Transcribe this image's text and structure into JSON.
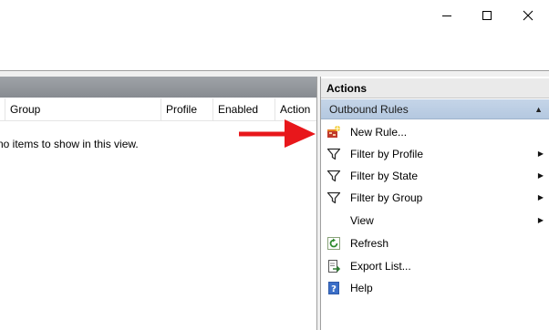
{
  "window": {
    "minimize_icon": "minimize-icon",
    "maximize_icon": "maximize-icon",
    "close_icon": "close-icon"
  },
  "rules_table": {
    "columns": [
      "Group",
      "Profile",
      "Enabled",
      "Action"
    ],
    "empty_message": "no items to show in this view."
  },
  "actions_pane": {
    "title": "Actions",
    "section": "Outbound Rules",
    "items": [
      {
        "label": "New Rule...",
        "icon": "new-rule-icon"
      },
      {
        "label": "Filter by Profile",
        "icon": "filter-icon",
        "submenu": true
      },
      {
        "label": "Filter by State",
        "icon": "filter-icon",
        "submenu": true
      },
      {
        "label": "Filter by Group",
        "icon": "filter-icon",
        "submenu": true
      },
      {
        "label": "View",
        "icon": "",
        "submenu": true
      },
      {
        "label": "Refresh",
        "icon": "refresh-icon"
      },
      {
        "label": "Export List...",
        "icon": "export-icon"
      },
      {
        "label": "Help",
        "icon": "help-icon"
      }
    ]
  },
  "annotation": {
    "arrow_color": "#e8171b"
  },
  "colors": {
    "section_header": "#b4c8e0",
    "pane_header": "#8f9399"
  }
}
